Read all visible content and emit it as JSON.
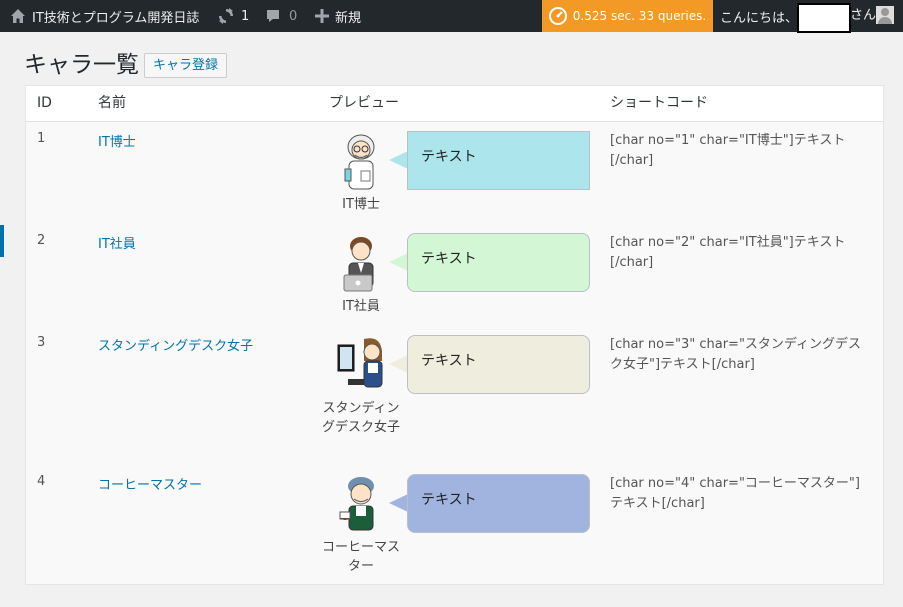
{
  "adminbar": {
    "site_title": "IT技術とプログラム開発日誌",
    "updates_count": "1",
    "comments_count": "0",
    "new_label": "新規",
    "perf_text": "0.525 sec. 33 queries.",
    "greeting": "こんにちは、",
    "honorific": "さん"
  },
  "page": {
    "title": "キャラ一覧",
    "add_button": "キャラ登録"
  },
  "table": {
    "headers": {
      "id": "ID",
      "name": "名前",
      "preview": "プレビュー",
      "shortcode": "ショートコード"
    },
    "rows": [
      {
        "id": "1",
        "name": "IT博士",
        "figure_label": "IT博士",
        "bubble_text": "テキスト",
        "bubble_color": "#ace6ec",
        "shortcode": "[char no=\"1\" char=\"IT博士\"]テキスト[/char]"
      },
      {
        "id": "2",
        "name": "IT社員",
        "figure_label": "IT社員",
        "bubble_text": "テキスト",
        "bubble_color": "#d3f7d5",
        "shortcode": "[char no=\"2\" char=\"IT社員\"]テキスト[/char]"
      },
      {
        "id": "3",
        "name": "スタンディングデスク女子",
        "figure_label": "スタンディングデスク女子",
        "bubble_text": "テキスト",
        "bubble_color": "#eeedde",
        "shortcode": "[char no=\"3\" char=\"スタンディングデスク女子\"]テキスト[/char]"
      },
      {
        "id": "4",
        "name": "コーヒーマスター",
        "figure_label": "コーヒーマスター",
        "bubble_text": "テキスト",
        "bubble_color": "#a0b4df",
        "shortcode": "[char no=\"4\" char=\"コーヒーマスター\"]テキスト[/char]"
      }
    ]
  }
}
